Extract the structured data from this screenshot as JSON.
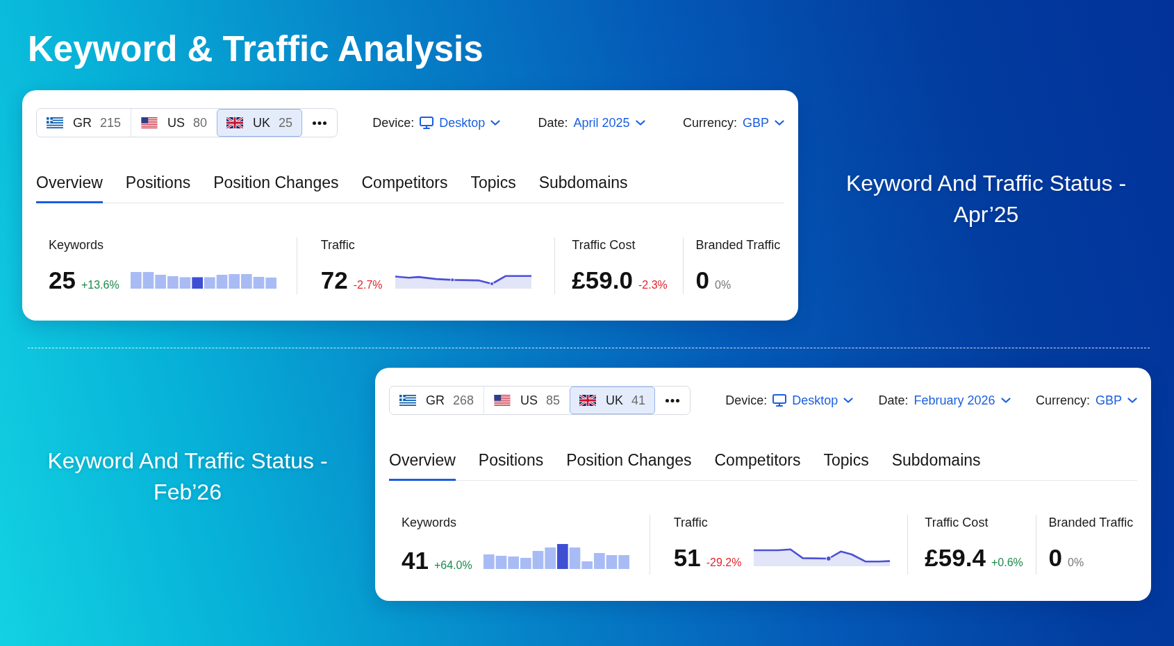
{
  "title": "Keyword & Traffic Analysis",
  "panels": [
    {
      "countries": [
        {
          "code": "GR",
          "count": "215",
          "selected": false
        },
        {
          "code": "US",
          "count": "80",
          "selected": false
        },
        {
          "code": "UK",
          "count": "25",
          "selected": true
        }
      ],
      "filters": [
        {
          "kind": "device",
          "label": "Device:",
          "value": "Desktop"
        },
        {
          "kind": "date",
          "label": "Date:",
          "value": "April 2025"
        },
        {
          "kind": "currency",
          "label": "Currency:",
          "value": "GBP"
        }
      ],
      "tabs": [
        {
          "label": "Overview",
          "selected": true
        },
        {
          "label": "Positions",
          "selected": false
        },
        {
          "label": "Position Changes",
          "selected": false
        },
        {
          "label": "Competitors",
          "selected": false
        },
        {
          "label": "Topics",
          "selected": false
        },
        {
          "label": "Subdomains",
          "selected": false
        }
      ],
      "metrics": [
        {
          "kind": "bars",
          "label": "Keywords",
          "value": "25",
          "change": "+13.6%",
          "color": "#1c8a4a"
        },
        {
          "kind": "line",
          "label": "Traffic",
          "value": "72",
          "change": "-2.7%",
          "color": "#e3262b"
        },
        {
          "kind": "plain",
          "label": "Traffic Cost",
          "value": "£59.0",
          "change": "-2.3%",
          "color": "#e3262b"
        },
        {
          "kind": "plain",
          "label": "Branded Traffic",
          "value": "0",
          "change": "0%",
          "color": "#777777"
        }
      ],
      "caption": "Keyword And Traffic Status - Apr’25"
    },
    {
      "countries": [
        {
          "code": "GR",
          "count": "268",
          "selected": false
        },
        {
          "code": "US",
          "count": "85",
          "selected": false
        },
        {
          "code": "UK",
          "count": "41",
          "selected": true
        }
      ],
      "filters": [
        {
          "kind": "device",
          "label": "Device:",
          "value": "Desktop"
        },
        {
          "kind": "date",
          "label": "Date:",
          "value": "February 2026"
        },
        {
          "kind": "currency",
          "label": "Currency:",
          "value": "GBP"
        }
      ],
      "tabs": [
        {
          "label": "Overview",
          "selected": true
        },
        {
          "label": "Positions",
          "selected": false
        },
        {
          "label": "Position Changes",
          "selected": false
        },
        {
          "label": "Competitors",
          "selected": false
        },
        {
          "label": "Topics",
          "selected": false
        },
        {
          "label": "Subdomains",
          "selected": false
        }
      ],
      "metrics": [
        {
          "kind": "bars",
          "label": "Keywords",
          "value": "41",
          "change": "+64.0%",
          "color": "#1c8a4a"
        },
        {
          "kind": "line",
          "label": "Traffic",
          "value": "51",
          "change": "-29.2%",
          "color": "#e3262b"
        },
        {
          "kind": "plain",
          "label": "Traffic Cost",
          "value": "£59.4",
          "change": "+0.6%",
          "color": "#1c8a4a"
        },
        {
          "kind": "plain",
          "label": "Branded Traffic",
          "value": "0",
          "change": "0%",
          "color": "#777777"
        }
      ],
      "caption": "Keyword And Traffic Status - Feb’26"
    }
  ]
}
